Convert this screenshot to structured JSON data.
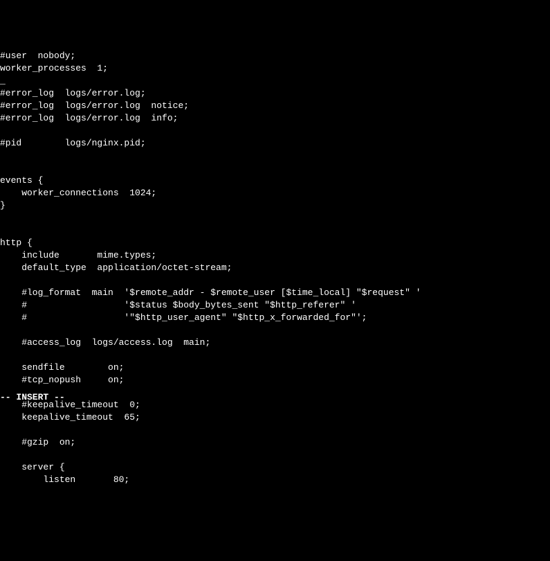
{
  "editor": {
    "lines": [
      "#user  nobody;",
      "worker_processes  1;",
      "_",
      "#error_log  logs/error.log;",
      "#error_log  logs/error.log  notice;",
      "#error_log  logs/error.log  info;",
      "",
      "#pid        logs/nginx.pid;",
      "",
      "",
      "events {",
      "    worker_connections  1024;",
      "}",
      "",
      "",
      "http {",
      "    include       mime.types;",
      "    default_type  application/octet-stream;",
      "",
      "    #log_format  main  '$remote_addr - $remote_user [$time_local] \"$request\" '",
      "    #                  '$status $body_bytes_sent \"$http_referer\" '",
      "    #                  '\"$http_user_agent\" \"$http_x_forwarded_for\"';",
      "",
      "    #access_log  logs/access.log  main;",
      "",
      "    sendfile        on;",
      "    #tcp_nopush     on;",
      "",
      "    #keepalive_timeout  0;",
      "    keepalive_timeout  65;",
      "",
      "    #gzip  on;",
      "",
      "    server {",
      "        listen       80;"
    ]
  },
  "status": {
    "mode": "-- INSERT --"
  }
}
